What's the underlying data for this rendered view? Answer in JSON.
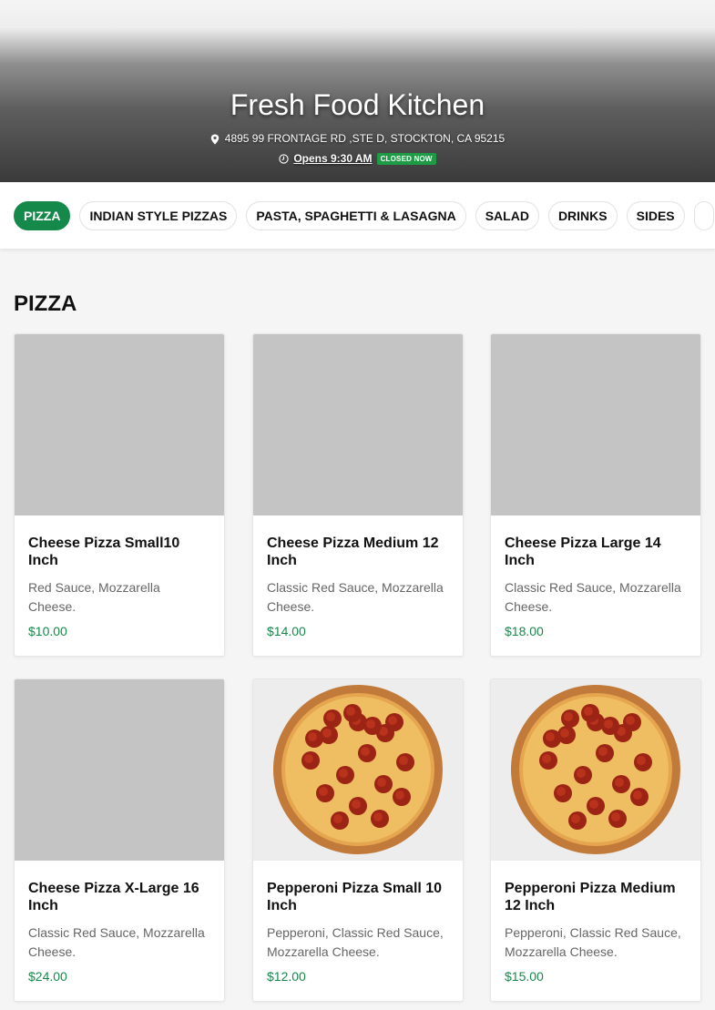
{
  "restaurant": {
    "name": "Fresh Food Kitchen",
    "address": "4895 99 FRONTAGE RD ,STE D, STOCKTON, CA 95215",
    "hours_label": "Opens 9:30 AM",
    "status_badge": "CLOSED NOW"
  },
  "categories": [
    {
      "label": "PIZZA",
      "active": true
    },
    {
      "label": "INDIAN STYLE PIZZAS"
    },
    {
      "label": "PASTA, SPAGHETTI & LASAGNA"
    },
    {
      "label": "SALAD"
    },
    {
      "label": "DRINKS"
    },
    {
      "label": "SIDES"
    },
    {
      "label": ""
    }
  ],
  "section": {
    "title": "PIZZA"
  },
  "items": [
    {
      "name": "Cheese Pizza Small10 Inch",
      "description": "Red Sauce, Mozzarella Cheese.",
      "price": "$10.00",
      "image": "placeholder"
    },
    {
      "name": "Cheese Pizza Medium 12 Inch",
      "description": "Classic Red Sauce, Mozzarella Cheese.",
      "price": "$14.00",
      "image": "placeholder"
    },
    {
      "name": "Cheese Pizza Large 14 Inch",
      "description": "Classic Red Sauce, Mozzarella Cheese.",
      "price": "$18.00",
      "image": "placeholder"
    },
    {
      "name": "Cheese Pizza X-Large 16 Inch",
      "description": "Classic Red Sauce, Mozzarella Cheese.",
      "price": "$24.00",
      "image": "placeholder"
    },
    {
      "name": "Pepperoni Pizza Small 10 Inch",
      "description": "Pepperoni, Classic Red Sauce, Mozzarella Cheese.",
      "price": "$12.00",
      "image": "pepperoni-pizza-photo"
    },
    {
      "name": "Pepperoni Pizza Medium 12 Inch",
      "description": "Pepperoni, Classic Red Sauce, Mozzarella Cheese.",
      "price": "$15.00",
      "image": "pepperoni-pizza-photo"
    }
  ],
  "colors": {
    "accent": "#14894a",
    "badge": "#1e9b45",
    "placeholder": "#c4c4c4"
  },
  "icons": {
    "address": "map-pin-icon",
    "hours": "clock-icon"
  }
}
